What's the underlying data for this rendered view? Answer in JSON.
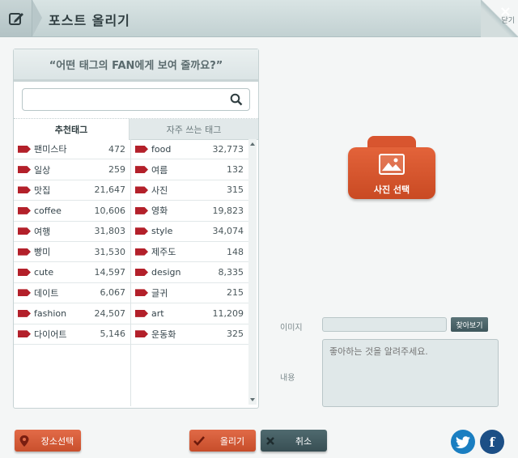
{
  "header": {
    "title": "포스트 올리기",
    "close_label": "×",
    "peel_label": "닫기"
  },
  "panel": {
    "question": "“어떤 태그의 FAN에게 보여 줄까요?”",
    "search_placeholder": "",
    "tabs": [
      {
        "label": "추천태그",
        "active": true
      },
      {
        "label": "자주 쓰는 태그",
        "active": false
      }
    ],
    "recommended_tags": [
      {
        "name": "팬미스타",
        "count": "472"
      },
      {
        "name": "일상",
        "count": "259"
      },
      {
        "name": "맛집",
        "count": "21,647"
      },
      {
        "name": "coffee",
        "count": "10,606"
      },
      {
        "name": "여행",
        "count": "31,803"
      },
      {
        "name": "빵미",
        "count": "31,530"
      },
      {
        "name": "cute",
        "count": "14,597"
      },
      {
        "name": "데이트",
        "count": "6,067"
      },
      {
        "name": "fashion",
        "count": "24,507"
      },
      {
        "name": "다이어트",
        "count": "5,146"
      }
    ],
    "frequent_tags": [
      {
        "name": "food",
        "count": "32,773"
      },
      {
        "name": "여름",
        "count": "132"
      },
      {
        "name": "사진",
        "count": "315"
      },
      {
        "name": "영화",
        "count": "19,823"
      },
      {
        "name": "style",
        "count": "34,074"
      },
      {
        "name": "제주도",
        "count": "148"
      },
      {
        "name": "design",
        "count": "8,335"
      },
      {
        "name": "글귀",
        "count": "215"
      },
      {
        "name": "art",
        "count": "11,209"
      },
      {
        "name": "운동화",
        "count": "325"
      }
    ]
  },
  "photo": {
    "label": "사진 선택"
  },
  "form": {
    "image_label": "이미지",
    "image_value": "",
    "browse_label": "찾아보기",
    "content_label": "내용",
    "content_placeholder": "좋아하는 것을 알려주세요."
  },
  "buttons": {
    "location": "장소선택",
    "post": "올리기",
    "cancel": "취소"
  },
  "social": {
    "twitter": "t",
    "facebook": "f"
  },
  "colors": {
    "accent": "#d8552f",
    "dark": "#3f575c",
    "tag": "#b3202a"
  }
}
